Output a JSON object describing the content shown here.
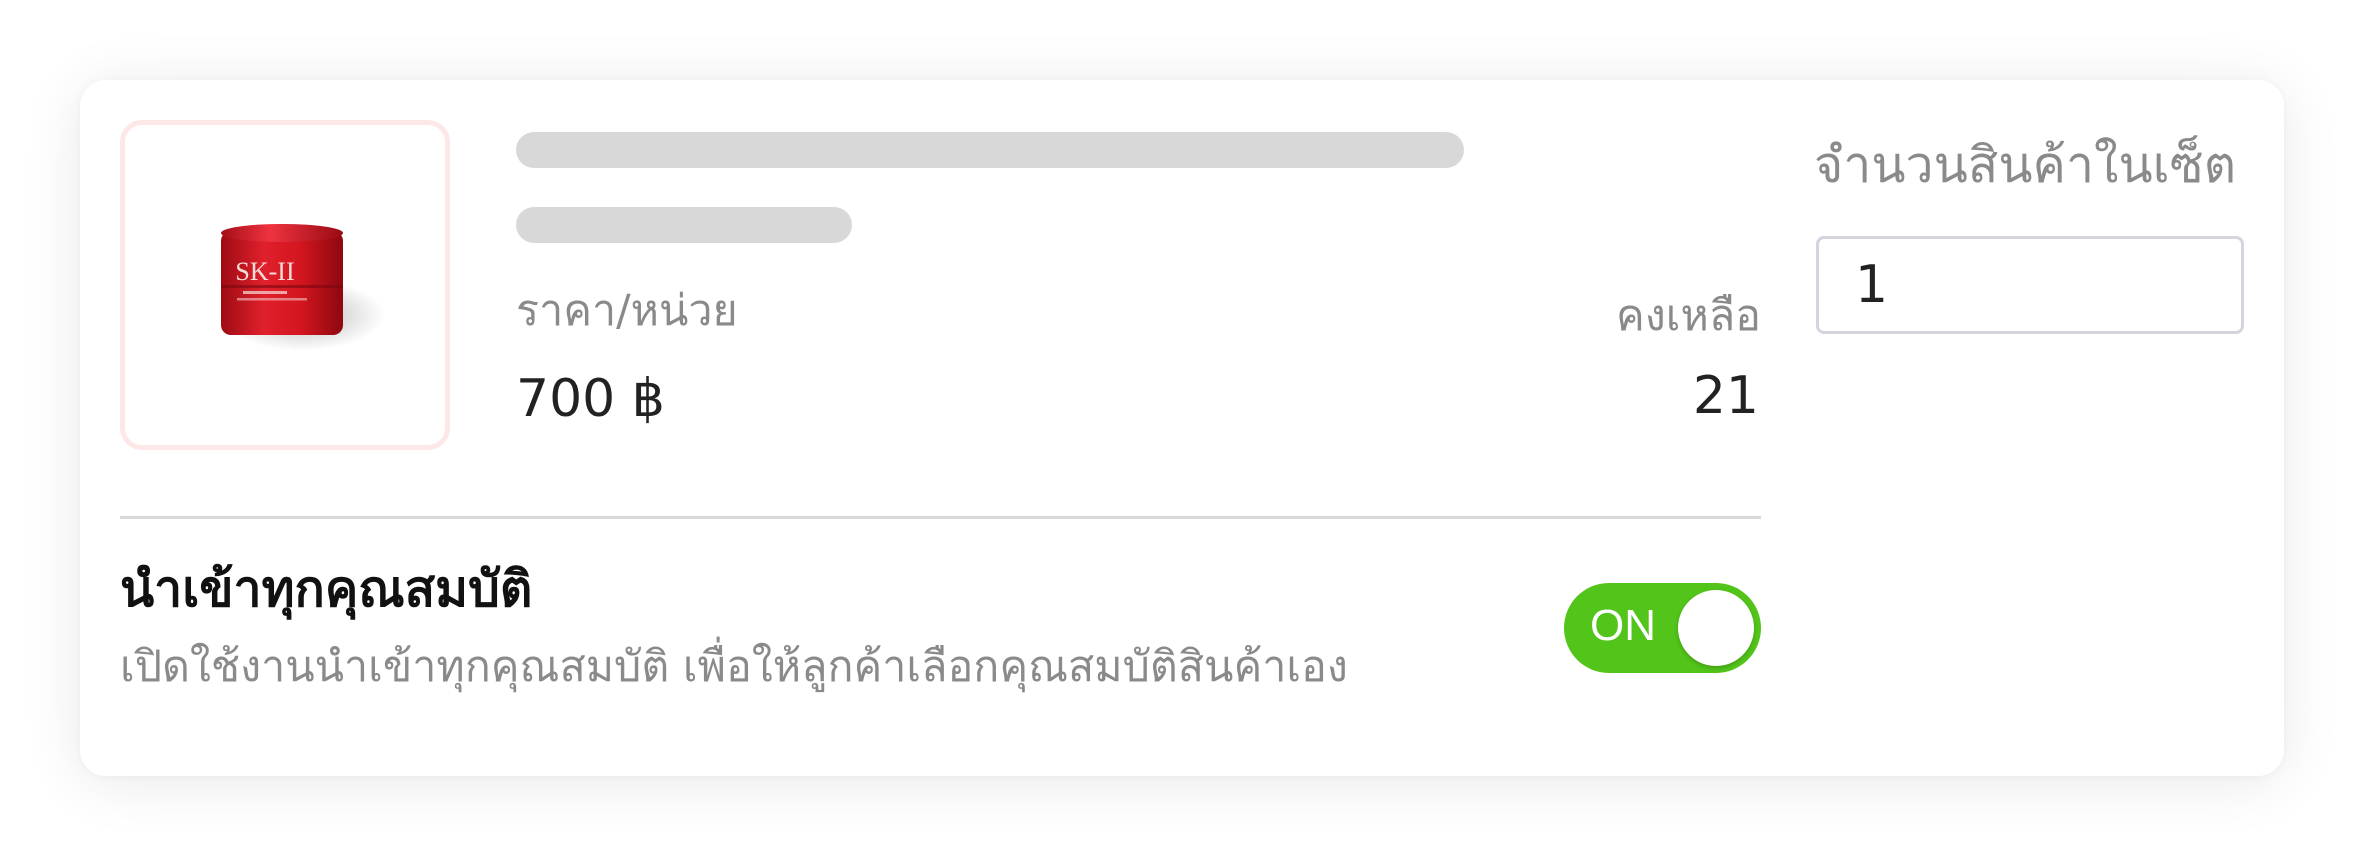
{
  "product": {
    "image_alt": "SK-II product jar",
    "brand_mark": "SK-II",
    "price_label": "ราคา/หน่วย",
    "price_value": "700 ฿",
    "stock_label": "คงเหลือ",
    "stock_value": "21"
  },
  "set_quantity": {
    "label": "จำนวนสินค้าในเซ็ต",
    "value": "1"
  },
  "import_all_attributes": {
    "title": "นำเข้าทุกคุณสมบัติ",
    "description": "เปิดใช้งานนำเข้าทุกคุณสมบัติ เพื่อให้ลูกค้าเลือกคุณสมบัติสินค้าเอง",
    "toggle_label": "ON",
    "toggle_on": true
  },
  "colors": {
    "accent_green": "#52c41a",
    "thumb_border": "#fde7e7",
    "skeleton": "#d8d8d8"
  }
}
